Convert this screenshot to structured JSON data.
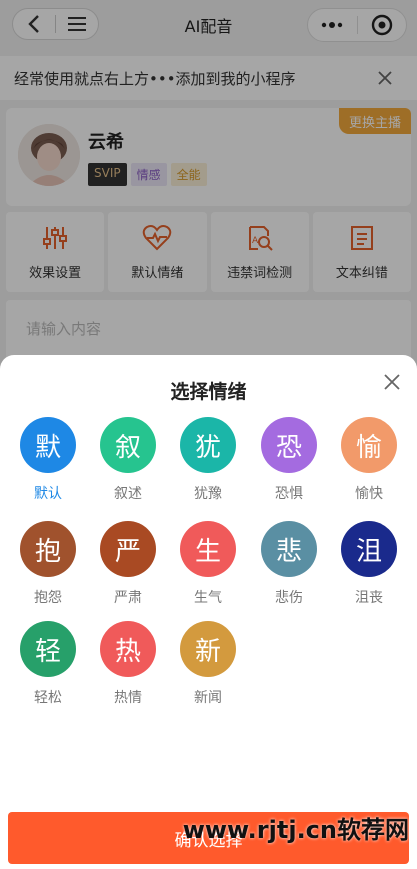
{
  "nav": {
    "title": "AI配音"
  },
  "tip": {
    "text": "经常使用就点右上方•••添加到我的小程序"
  },
  "anchor": {
    "name": "云希",
    "tags": [
      "SVIP",
      "情感",
      "全能"
    ],
    "switch_label": "更换主播"
  },
  "tools": [
    {
      "label": "效果设置",
      "icon": "sliders-icon"
    },
    {
      "label": "默认情绪",
      "icon": "heart-pulse-icon"
    },
    {
      "label": "违禁词检测",
      "icon": "doc-search-icon"
    },
    {
      "label": "文本纠错",
      "icon": "document-icon"
    }
  ],
  "editor": {
    "placeholder": "请输入内容"
  },
  "sheet": {
    "title": "选择情绪",
    "confirm_label": "确认选择",
    "emotions": [
      {
        "char": "默",
        "label": "默认",
        "color": "#1e88e5",
        "selected": true
      },
      {
        "char": "叙",
        "label": "叙述",
        "color": "#26c48f"
      },
      {
        "char": "犹",
        "label": "犹豫",
        "color": "#1bb6a8"
      },
      {
        "char": "恐",
        "label": "恐惧",
        "color": "#a46be0"
      },
      {
        "char": "愉",
        "label": "愉快",
        "color": "#f29a6a"
      },
      {
        "char": "抱",
        "label": "抱怨",
        "color": "#a0522d"
      },
      {
        "char": "严",
        "label": "严肃",
        "color": "#a94a23"
      },
      {
        "char": "生",
        "label": "生气",
        "color": "#f05a5a"
      },
      {
        "char": "悲",
        "label": "悲伤",
        "color": "#5a8fa3"
      },
      {
        "char": "沮",
        "label": "沮丧",
        "color": "#1a2a8c"
      },
      {
        "char": "轻",
        "label": "轻松",
        "color": "#27a06a"
      },
      {
        "char": "热",
        "label": "热情",
        "color": "#f05a5a"
      },
      {
        "char": "新",
        "label": "新闻",
        "color": "#d39a3e"
      }
    ]
  },
  "watermark": "www.rjtj.cn软荐网"
}
